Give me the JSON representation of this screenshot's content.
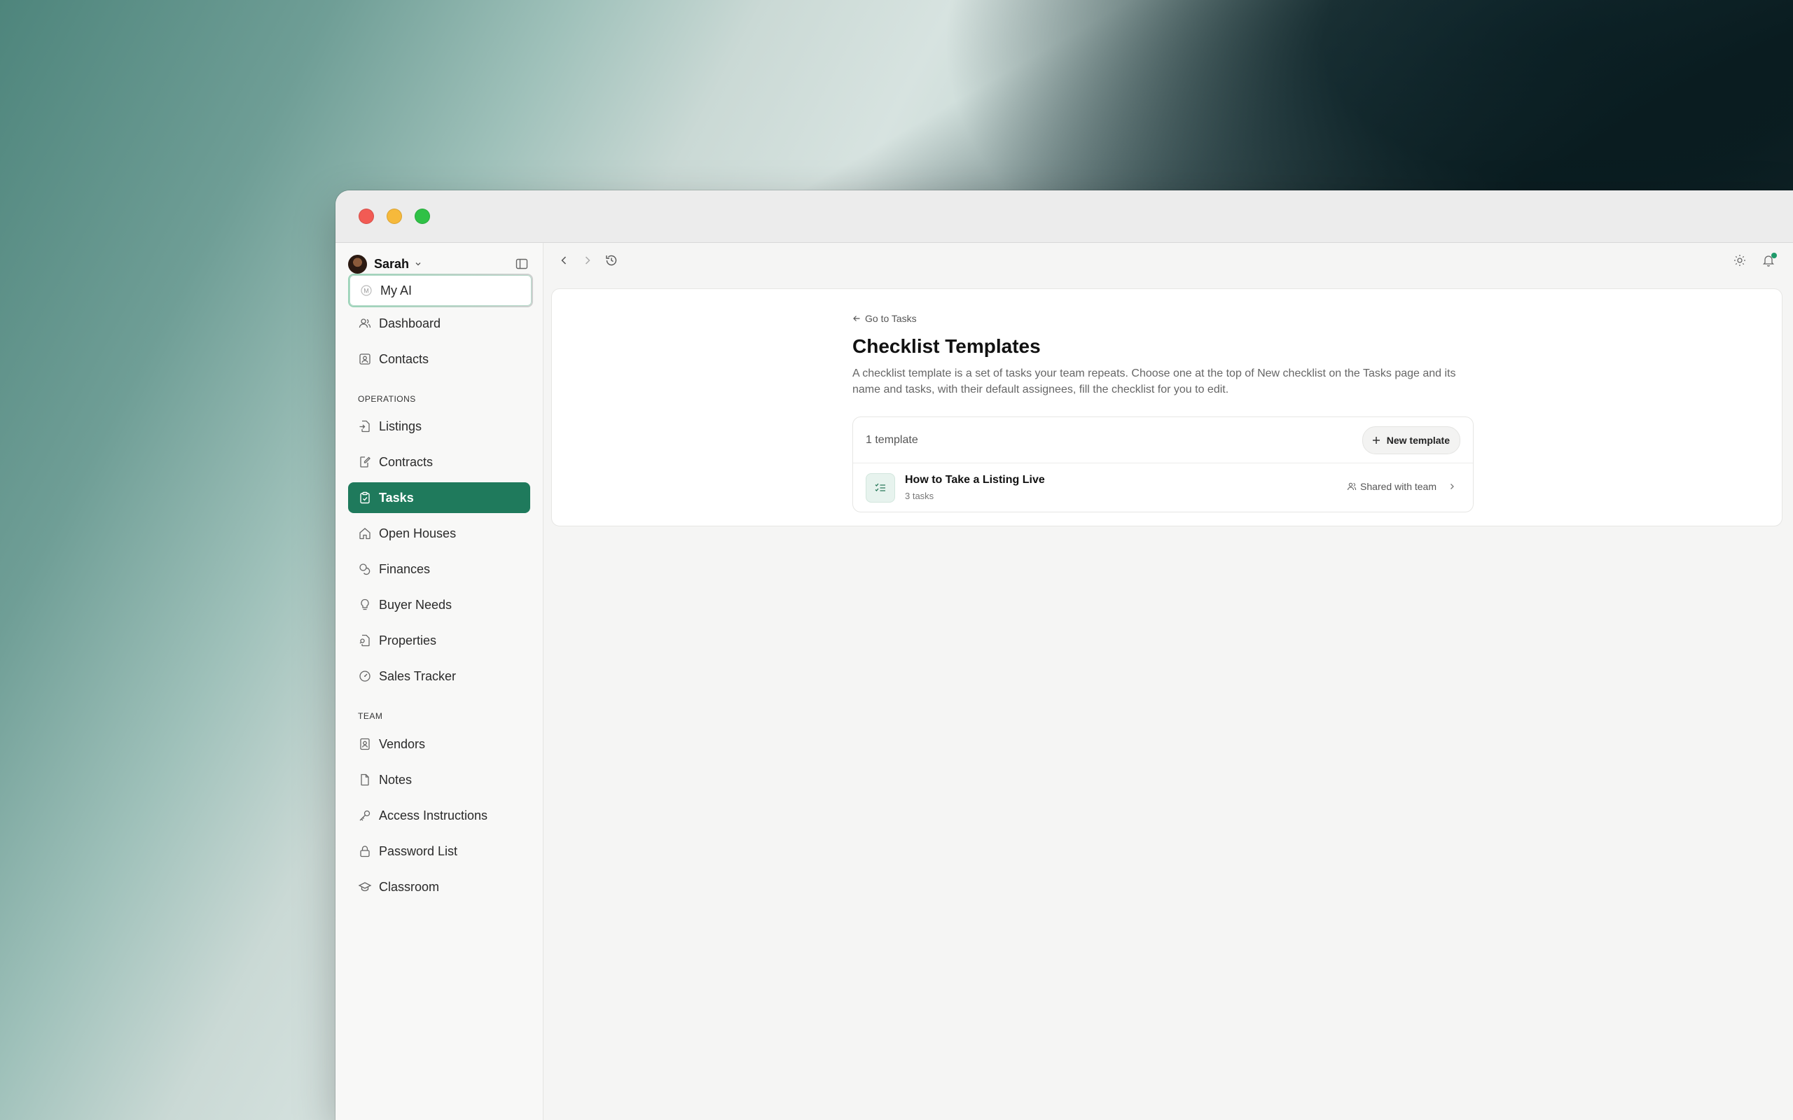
{
  "user": {
    "name": "Sarah"
  },
  "nav": {
    "my_ai": "My AI",
    "dashboard": "Dashboard",
    "contacts": "Contacts",
    "operations_label": "OPERATIONS",
    "listings": "Listings",
    "contracts": "Contracts",
    "tasks": "Tasks",
    "open_houses": "Open Houses",
    "finances": "Finances",
    "buyer_needs": "Buyer Needs",
    "properties": "Properties",
    "sales_tracker": "Sales Tracker",
    "team_label": "TEAM",
    "vendors": "Vendors",
    "notes": "Notes",
    "access_instructions": "Access Instructions",
    "password_list": "Password List",
    "classroom": "Classroom",
    "active_item": "Tasks"
  },
  "page": {
    "back_link": "Go to Tasks",
    "title": "Checklist Templates",
    "description": "A checklist template is a set of tasks your team repeats. Choose one at the top of New checklist on the Tasks page and its name and tasks, with their default assignees, fill the checklist for you to edit."
  },
  "templates": {
    "count_label": "1 template",
    "new_button": "New template",
    "items": [
      {
        "name": "How to Take a Listing Live",
        "task_count": "3 tasks",
        "sharing": "Shared with team"
      }
    ]
  },
  "colors": {
    "accent": "#1f7a5c",
    "notification_dot": "#1f9a6a"
  },
  "icons": [
    "sidebar-toggle-icon",
    "back-arrow-icon",
    "forward-arrow-icon",
    "history-icon",
    "sun-icon",
    "bell-icon"
  ]
}
